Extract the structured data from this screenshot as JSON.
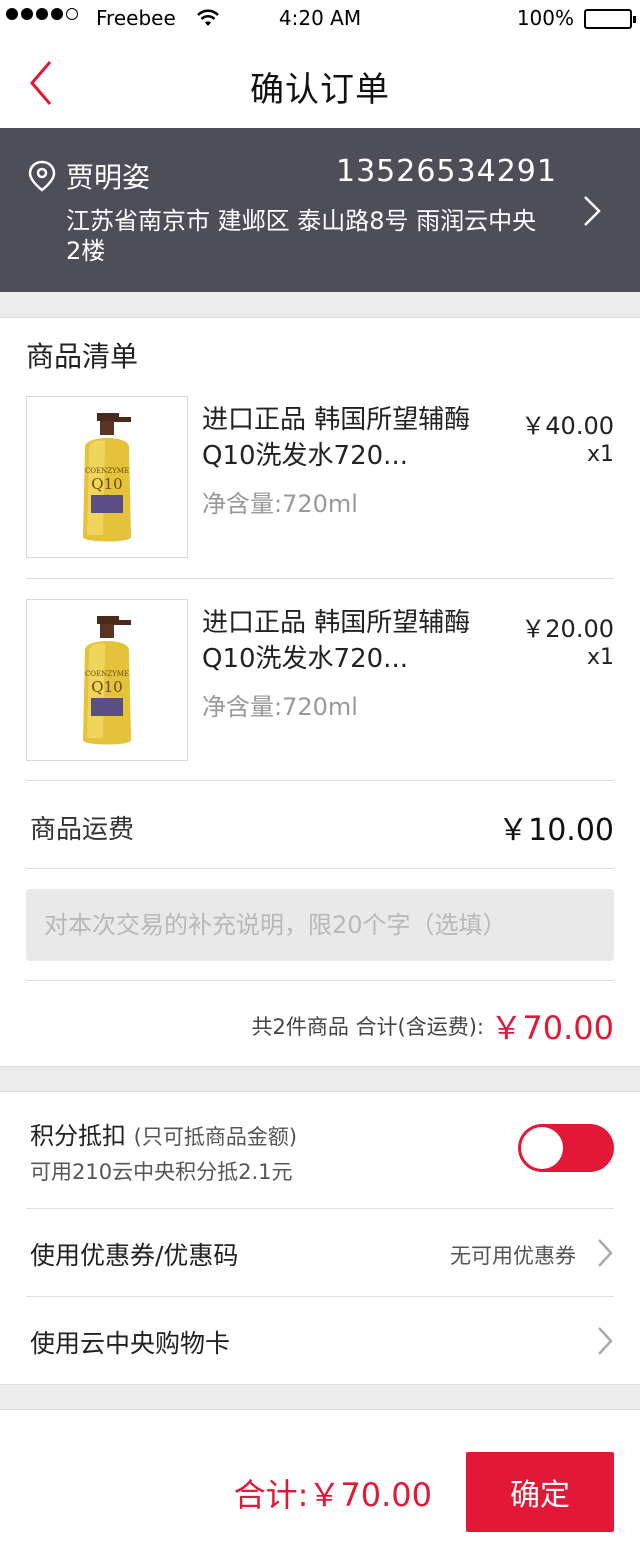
{
  "status_bar": {
    "carrier": "Freebee",
    "time": "4:20 AM",
    "battery": "100%"
  },
  "nav": {
    "title": "确认订单"
  },
  "address": {
    "name": "贾明姿",
    "phone": "13526534291",
    "detail": "江苏省南京市 建邺区 泰山路8号 雨润云中央2楼"
  },
  "goods": {
    "section_title": "商品清单",
    "items": [
      {
        "name": "进口正品 韩国所望辅酶Q10洗发水720...",
        "spec": "净含量:720ml",
        "price": "￥40.00",
        "qty": "x1"
      },
      {
        "name": "进口正品 韩国所望辅酶Q10洗发水720...",
        "spec": "净含量:720ml",
        "price": "￥20.00",
        "qty": "x1"
      }
    ],
    "freight_label": "商品运费",
    "freight_value": "￥10.00",
    "note_placeholder": "对本次交易的补充说明，限20个字（选填）",
    "count_text": "共2件商品  合计(含运费):",
    "total": "￥70.00"
  },
  "points": {
    "label": "积分抵扣",
    "label_sub": "(只可抵商品金额)",
    "desc": "可用210云中央积分抵2.1元",
    "enabled": true
  },
  "coupon": {
    "label": "使用优惠券/优惠码",
    "value": "无可用优惠券"
  },
  "card": {
    "label": "使用云中央购物卡"
  },
  "footer": {
    "sum": "合计:￥70.00",
    "confirm": "确定"
  },
  "colors": {
    "accent": "#e21836",
    "address_bg": "#4d4e58"
  }
}
